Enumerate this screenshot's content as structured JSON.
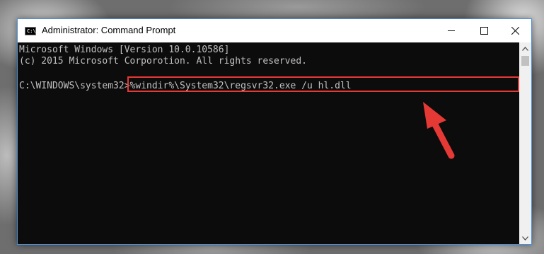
{
  "window": {
    "title": "Administrator: Command Prompt",
    "app_icon_glyph": "C:\\",
    "controls": {
      "minimize": "minimize-icon",
      "maximize": "maximize-icon",
      "close": "close-icon"
    }
  },
  "console": {
    "line1": "Microsoft Windows [Version 10.0.10586]",
    "line2": "(c) 2015 Microsoft Corporotion. All rights reserved.",
    "prompt": "C:\\WINDOWS\\system32>",
    "command": "%windir%\\System32\\regsvr32.exe /u hl.dll"
  },
  "colors": {
    "console_bg": "#0c0c0c",
    "console_text": "#c0c0c0",
    "highlight": "#e53935",
    "annotation_arrow": "#e53935"
  },
  "annotations": {
    "arrow": "red-arrow-icon"
  }
}
